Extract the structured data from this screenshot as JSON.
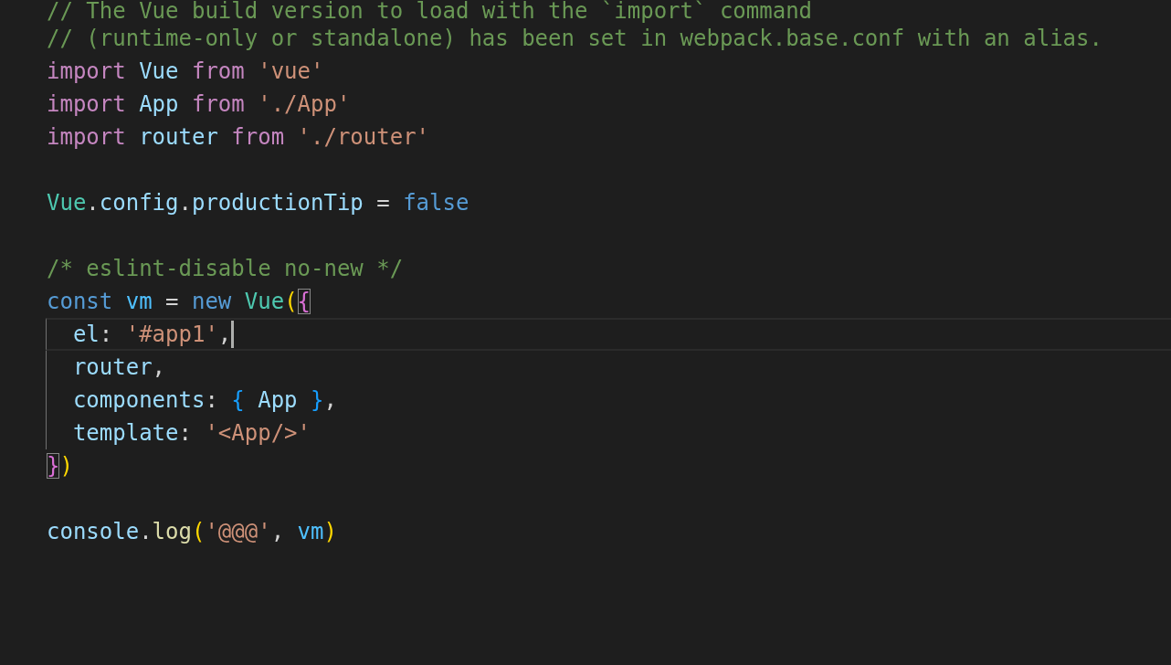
{
  "editor": {
    "lines": [
      {
        "kind": "code",
        "in_block": false,
        "current": false,
        "tokens": [
          {
            "text": "// The Vue build version to load with the `import` command",
            "kind": "comment"
          }
        ]
      },
      {
        "kind": "code",
        "in_block": false,
        "current": false,
        "tokens": [
          {
            "text": "// (runtime-only or standalone) has been set in webpack.base.conf with an alias.",
            "kind": "comment"
          }
        ]
      },
      {
        "kind": "code",
        "in_block": false,
        "current": false,
        "tokens": [
          {
            "text": "import ",
            "kind": "keyword"
          },
          {
            "text": "Vue ",
            "kind": "variable"
          },
          {
            "text": "from ",
            "kind": "keyword"
          },
          {
            "text": "'vue'",
            "kind": "string"
          }
        ]
      },
      {
        "kind": "code",
        "in_block": false,
        "current": false,
        "tokens": [
          {
            "text": "import ",
            "kind": "keyword"
          },
          {
            "text": "App ",
            "kind": "variable"
          },
          {
            "text": "from ",
            "kind": "keyword"
          },
          {
            "text": "'./App'",
            "kind": "string"
          }
        ]
      },
      {
        "kind": "code",
        "in_block": false,
        "current": false,
        "tokens": [
          {
            "text": "import ",
            "kind": "keyword"
          },
          {
            "text": "router ",
            "kind": "variable"
          },
          {
            "text": "from ",
            "kind": "keyword"
          },
          {
            "text": "'./router'",
            "kind": "string"
          }
        ]
      },
      {
        "kind": "blank"
      },
      {
        "kind": "code",
        "in_block": false,
        "current": false,
        "tokens": [
          {
            "text": "Vue",
            "kind": "class"
          },
          {
            "text": ".",
            "kind": "plain"
          },
          {
            "text": "config",
            "kind": "variable"
          },
          {
            "text": ".",
            "kind": "plain"
          },
          {
            "text": "productionTip",
            "kind": "variable"
          },
          {
            "text": " = ",
            "kind": "plain"
          },
          {
            "text": "false",
            "kind": "storage"
          }
        ]
      },
      {
        "kind": "blank"
      },
      {
        "kind": "code",
        "in_block": false,
        "current": false,
        "tokens": [
          {
            "text": "/* eslint-disable no-new */",
            "kind": "comment"
          }
        ]
      },
      {
        "kind": "code",
        "in_block": false,
        "current": false,
        "tokens": [
          {
            "text": "const ",
            "kind": "storage"
          },
          {
            "text": "vm",
            "kind": "constant"
          },
          {
            "text": " = ",
            "kind": "plain"
          },
          {
            "text": "new ",
            "kind": "storage"
          },
          {
            "text": "Vue",
            "kind": "class"
          },
          {
            "text": "(",
            "kind": "bracket1"
          },
          {
            "text": "{",
            "kind": "bracket2",
            "matched": true
          }
        ]
      },
      {
        "kind": "code",
        "in_block": true,
        "current": true,
        "tokens": [
          {
            "text": "  el",
            "kind": "variable"
          },
          {
            "text": ": ",
            "kind": "plain"
          },
          {
            "text": "'#app1'",
            "kind": "string"
          },
          {
            "text": ",",
            "kind": "plain"
          }
        ]
      },
      {
        "kind": "code",
        "in_block": true,
        "current": false,
        "tokens": [
          {
            "text": "  router",
            "kind": "variable"
          },
          {
            "text": ",",
            "kind": "plain"
          }
        ]
      },
      {
        "kind": "code",
        "in_block": true,
        "current": false,
        "tokens": [
          {
            "text": "  components",
            "kind": "variable"
          },
          {
            "text": ": ",
            "kind": "plain"
          },
          {
            "text": "{ ",
            "kind": "bracket3"
          },
          {
            "text": "App ",
            "kind": "variable"
          },
          {
            "text": "}",
            "kind": "bracket3"
          },
          {
            "text": ",",
            "kind": "plain"
          }
        ]
      },
      {
        "kind": "code",
        "in_block": true,
        "current": false,
        "tokens": [
          {
            "text": "  template",
            "kind": "variable"
          },
          {
            "text": ": ",
            "kind": "plain"
          },
          {
            "text": "'<App/>'",
            "kind": "string"
          }
        ]
      },
      {
        "kind": "code",
        "in_block": false,
        "current": false,
        "tokens": [
          {
            "text": "}",
            "kind": "bracket2",
            "matched": true
          },
          {
            "text": ")",
            "kind": "bracket1"
          }
        ]
      },
      {
        "kind": "blank"
      },
      {
        "kind": "code",
        "in_block": false,
        "current": false,
        "tokens": [
          {
            "text": "console",
            "kind": "variable"
          },
          {
            "text": ".",
            "kind": "plain"
          },
          {
            "text": "log",
            "kind": "function"
          },
          {
            "text": "(",
            "kind": "bracket1"
          },
          {
            "text": "'@@@'",
            "kind": "string"
          },
          {
            "text": ", ",
            "kind": "plain"
          },
          {
            "text": "vm",
            "kind": "constant"
          },
          {
            "text": ")",
            "kind": "bracket1"
          }
        ]
      }
    ]
  }
}
